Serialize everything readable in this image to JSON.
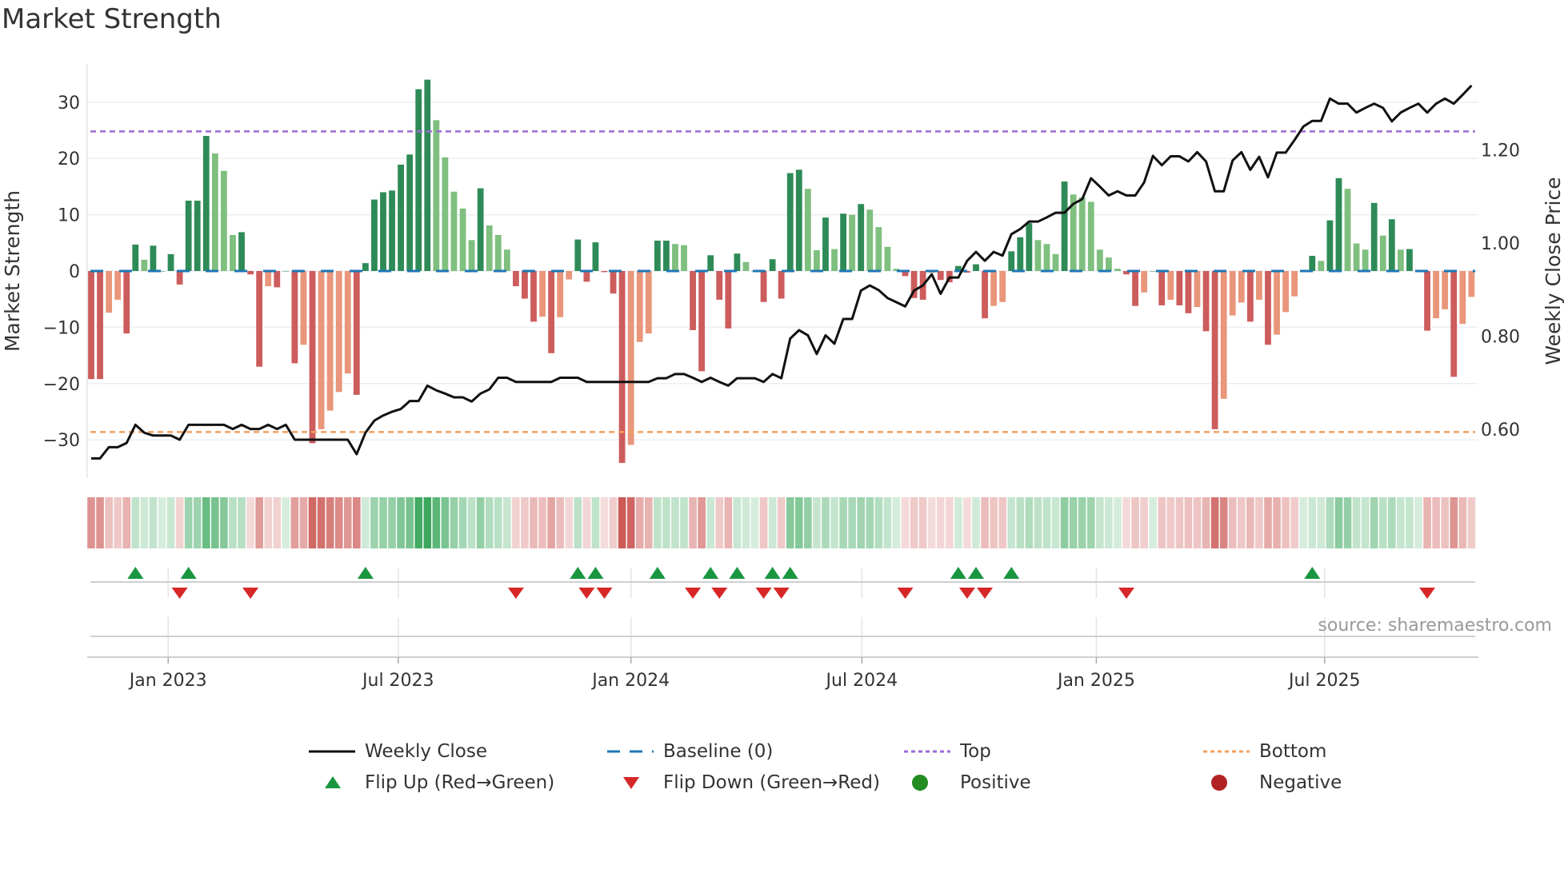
{
  "chart_data": {
    "type": "bar",
    "title": "Market Strength",
    "ylabel": "Market Strength",
    "y2label": "Weekly Close Price",
    "ylim": [
      -37,
      37
    ],
    "y2lim": [
      0.5,
      1.385
    ],
    "yticks": [
      30,
      20,
      10,
      0,
      -10,
      -20,
      -30
    ],
    "ytick_labels": [
      "30",
      "20",
      "10",
      "0",
      "−10",
      "−20",
      "−30"
    ],
    "y2ticks": [
      1.2,
      1.0,
      0.8,
      0.6
    ],
    "y2tick_labels": [
      "1.20",
      "1.00",
      "0.80",
      "0.60"
    ],
    "xticks": [
      {
        "label": "Jan 2023",
        "week": 8.7
      },
      {
        "label": "Jul 2023",
        "week": 34.7
      },
      {
        "label": "Jan 2024",
        "week": 61.0
      },
      {
        "label": "Jul 2024",
        "week": 87.1
      },
      {
        "label": "Jan 2025",
        "week": 113.6
      },
      {
        "label": "Jul 2025",
        "week": 139.4
      }
    ],
    "top_level": 24.8,
    "bottom_level": -28.6,
    "baseline": 0,
    "strength": [
      -19.2,
      -19.2,
      -7.4,
      -5.1,
      -11.1,
      4.7,
      2.0,
      4.5,
      0,
      3.0,
      -2.4,
      12.5,
      12.5,
      24,
      20.9,
      17.8,
      6.4,
      6.9,
      -0.6,
      -17,
      -2.7,
      -2.9,
      0,
      -16.4,
      -13.1,
      -30.6,
      -28.1,
      -24.8,
      -21.5,
      -18.2,
      -22,
      1.4,
      12.7,
      14,
      14.3,
      18.9,
      20.7,
      32.3,
      34,
      26.8,
      20.2,
      14.1,
      11.1,
      5.5,
      14.7,
      8.1,
      6.4,
      3.8,
      -2.7,
      -4.9,
      -9.0,
      -8.1,
      -14.6,
      -8.2,
      -1.5,
      5.6,
      -1.9,
      5.1,
      -0.2,
      -4.0,
      -34.1,
      -30.9,
      -12.6,
      -11.1,
      5.4,
      5.4,
      4.8,
      4.6,
      -10.5,
      -17.8,
      2.8,
      -5.1,
      -10.2,
      3.1,
      1.6,
      0,
      -5.5,
      2.1,
      -4.9,
      17.4,
      18.0,
      14.6,
      3.7,
      9.5,
      3.9,
      10.2,
      10,
      11.9,
      10.9,
      7.8,
      4.3,
      0.4,
      -0.9,
      -4.8,
      -5.1,
      -0.3,
      -1.6,
      -2,
      0.9,
      -0.3,
      1.2,
      -8.4,
      -6.2,
      -5.5,
      3.5,
      6,
      8.5,
      5.5,
      4.8,
      3,
      15.9,
      13.6,
      13.1,
      12.3,
      3.8,
      2.4,
      0.4,
      -0.6,
      -6.2,
      -3.8,
      0,
      -6.1,
      -5.1,
      -6.1,
      -7.5,
      -6.4,
      -10.7,
      -28.1,
      -22.7,
      -7.9,
      -5.6,
      -9,
      -5.1,
      -13.1,
      -11.3,
      -7.3,
      -4.5,
      0,
      2.7,
      1.8,
      9,
      16.5,
      14.6,
      4.9,
      3.8,
      12.1,
      6.3,
      9.2,
      3.8,
      3.9,
      0.2,
      -10.6,
      -8.4,
      -6.8,
      -18.8,
      -9.4,
      -4.6
    ],
    "weekly_close": [
      0.538,
      0.538,
      0.562,
      0.562,
      0.571,
      0.61,
      0.593,
      0.587,
      0.587,
      0.587,
      0.578,
      0.61,
      0.61,
      0.61,
      0.61,
      0.61,
      0.601,
      0.61,
      0.601,
      0.601,
      0.61,
      0.601,
      0.61,
      0.578,
      0.578,
      0.578,
      0.578,
      0.578,
      0.578,
      0.578,
      0.547,
      0.593,
      0.619,
      0.63,
      0.638,
      0.644,
      0.661,
      0.661,
      0.694,
      0.684,
      0.677,
      0.669,
      0.669,
      0.66,
      0.677,
      0.686,
      0.711,
      0.711,
      0.702,
      0.702,
      0.702,
      0.702,
      0.702,
      0.711,
      0.711,
      0.711,
      0.702,
      0.702,
      0.702,
      0.702,
      0.702,
      0.702,
      0.702,
      0.702,
      0.71,
      0.71,
      0.719,
      0.719,
      0.711,
      0.702,
      0.711,
      0.702,
      0.694,
      0.71,
      0.71,
      0.71,
      0.702,
      0.719,
      0.71,
      0.795,
      0.813,
      0.802,
      0.762,
      0.802,
      0.784,
      0.837,
      0.837,
      0.898,
      0.909,
      0.899,
      0.882,
      0.873,
      0.864,
      0.898,
      0.909,
      0.933,
      0.891,
      0.926,
      0.926,
      0.962,
      0.981,
      0.962,
      0.981,
      0.973,
      1.019,
      1.03,
      1.046,
      1.046,
      1.055,
      1.065,
      1.065,
      1.084,
      1.094,
      1.139,
      1.121,
      1.102,
      1.111,
      1.102,
      1.102,
      1.13,
      1.187,
      1.167,
      1.186,
      1.186,
      1.175,
      1.195,
      1.175,
      1.111,
      1.111,
      1.177,
      1.195,
      1.157,
      1.185,
      1.141,
      1.194,
      1.194,
      1.221,
      1.25,
      1.262,
      1.262,
      1.31,
      1.299,
      1.299,
      1.28,
      1.29,
      1.299,
      1.29,
      1.261,
      1.28,
      1.29,
      1.299,
      1.28,
      1.299,
      1.31,
      1.299,
      1.318,
      1.338
    ],
    "flip_up_weeks": [
      6,
      12,
      32,
      56,
      58,
      65,
      71,
      74,
      78,
      80,
      99,
      101,
      105,
      139
    ],
    "flip_down_weeks": [
      11,
      19,
      49,
      57,
      59,
      69,
      72,
      77,
      79,
      93,
      100,
      102,
      118,
      152
    ],
    "legend": [
      {
        "label": "Weekly Close",
        "kind": "line",
        "color": "#111111"
      },
      {
        "label": "Baseline (0)",
        "kind": "dash",
        "color": "#1f77b4"
      },
      {
        "label": "Top",
        "kind": "dot",
        "color": "#9b6bd6"
      },
      {
        "label": "Bottom",
        "kind": "dot",
        "color": "#f0a060"
      },
      {
        "label": "Flip Up (Red→Green)",
        "kind": "tri-up",
        "color": "#1a9641"
      },
      {
        "label": "Flip Down (Green→Red)",
        "kind": "tri-down",
        "color": "#d62728"
      },
      {
        "label": "Positive",
        "kind": "circle",
        "color": "#228b22"
      },
      {
        "label": "Negative",
        "kind": "circle",
        "color": "#b22222"
      }
    ],
    "legend_position": "bottom"
  },
  "colors": {
    "green_strong": "#2e8b57",
    "green_fading": "#7fbf7f",
    "red_strong": "#cd5c5c",
    "red_fading": "#e9967a",
    "heat_green": "#31a354",
    "heat_red": "#c9524e"
  },
  "source": "source: sharemaestro.com"
}
